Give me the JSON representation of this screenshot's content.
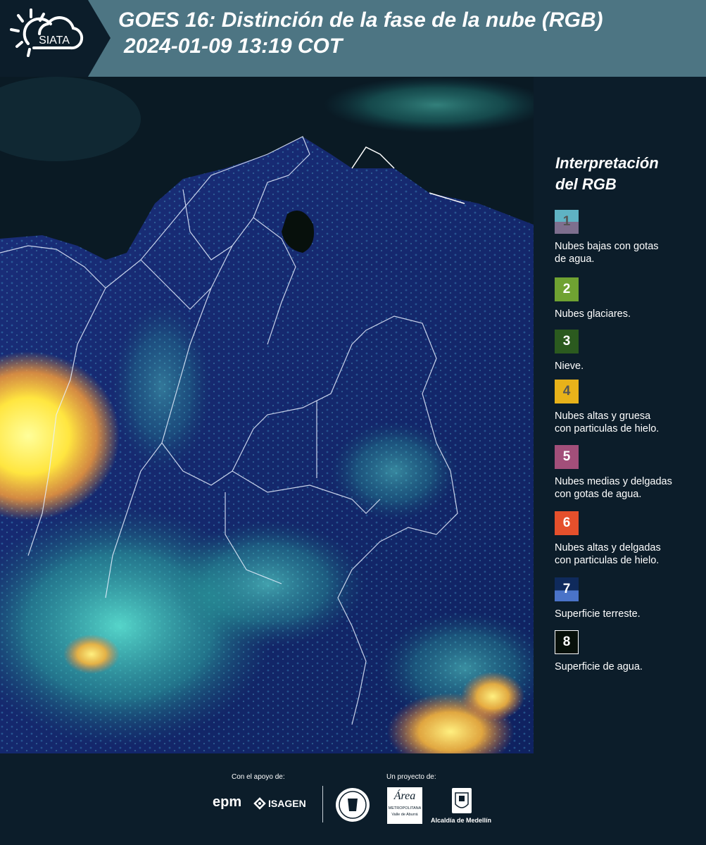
{
  "header": {
    "logo_text": "SIATA",
    "title_line1": "GOES 16: Distinción de la fase de la nube (RGB)",
    "title_line2": "2024-01-09 13:19 COT"
  },
  "legend": {
    "title_line1": "Interpretación",
    "title_line2": "del RGB",
    "items": [
      {
        "num": "1",
        "color_top": "#5fb3c4",
        "color_bottom": "#7e6f8e",
        "line1": "Nubes bajas con gotas",
        "line2": "de agua."
      },
      {
        "num": "2",
        "color_top": "#6fa232",
        "color_bottom": "#6fa232",
        "line1": "Nubes glaciares.",
        "line2": ""
      },
      {
        "num": "3",
        "color_top": "#2b5a1f",
        "color_bottom": "#2b5a1f",
        "line1": "Nieve.",
        "line2": ""
      },
      {
        "num": "4",
        "color_top": "#e8b21a",
        "color_bottom": "#e8b21a",
        "line1": "Nubes altas y gruesa",
        "line2": "con particulas de hielo."
      },
      {
        "num": "5",
        "color_top": "#a24f7a",
        "color_bottom": "#a24f7a",
        "line1": "Nubes medias y delgadas",
        "line2": "con gotas de agua."
      },
      {
        "num": "6",
        "color_top": "#e5502c",
        "color_bottom": "#e5502c",
        "line1": "Nubes altas y delgadas",
        "line2": "con particulas de hielo."
      },
      {
        "num": "7",
        "color_top": "#0f2a5c",
        "color_bottom": "#4a73c8",
        "line1": "Superficie terreste.",
        "line2": ""
      },
      {
        "num": "8",
        "color_top": "#07100a",
        "color_bottom": "#07100a",
        "line1": "Superficie de agua.",
        "line2": ""
      }
    ]
  },
  "footer": {
    "support_label": "Con el apoyo de:",
    "project_label": "Un proyecto de:",
    "epm": "epm",
    "isagen": "ISAGEN",
    "metro_brand": "Área",
    "metro_line1": "METROPOLITANA",
    "metro_line2": "Valle de Aburrá",
    "alcaldia": "Alcaldía de Medellín"
  }
}
